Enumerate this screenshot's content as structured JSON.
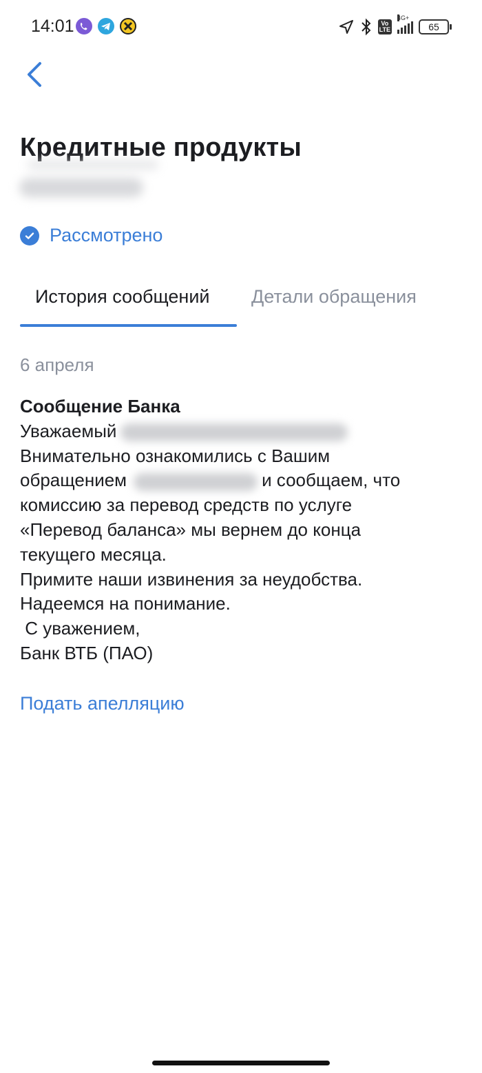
{
  "status_bar": {
    "time": "14:01",
    "app_icons": [
      "viber-icon",
      "telegram-icon",
      "app-notification-icon"
    ],
    "network": "4G+",
    "lte_badge": "Vo LTE",
    "battery": "65"
  },
  "header": {
    "back_icon": "chevron-left-icon",
    "title": "Кредитные продукты",
    "status": "Рассмотрено",
    "status_icon": "check-circle-icon"
  },
  "tabs": [
    {
      "label": "История сообщений",
      "active": true
    },
    {
      "label": "Детали обращения",
      "active": false
    }
  ],
  "message": {
    "date": "6 апреля",
    "title": "Сообщение Банка",
    "lines": [
      "Уважаемый",
      "Внимательно ознакомились с Вашим",
      "обращением",
      "и сообщаем, что",
      "комиссию за перевод средств по услуге",
      "«Перевод баланса» мы вернем до конца",
      "текущего месяца.",
      "Примите наши извинения за неудобства.",
      "Надеемся на понимание.",
      " С уважением,",
      "Банк ВТБ (ПАО)"
    ]
  },
  "actions": {
    "appeal": "Подать апелляцию"
  },
  "colors": {
    "accent": "#3b7ed7",
    "text": "#1c1d21",
    "muted": "#8a909c"
  }
}
